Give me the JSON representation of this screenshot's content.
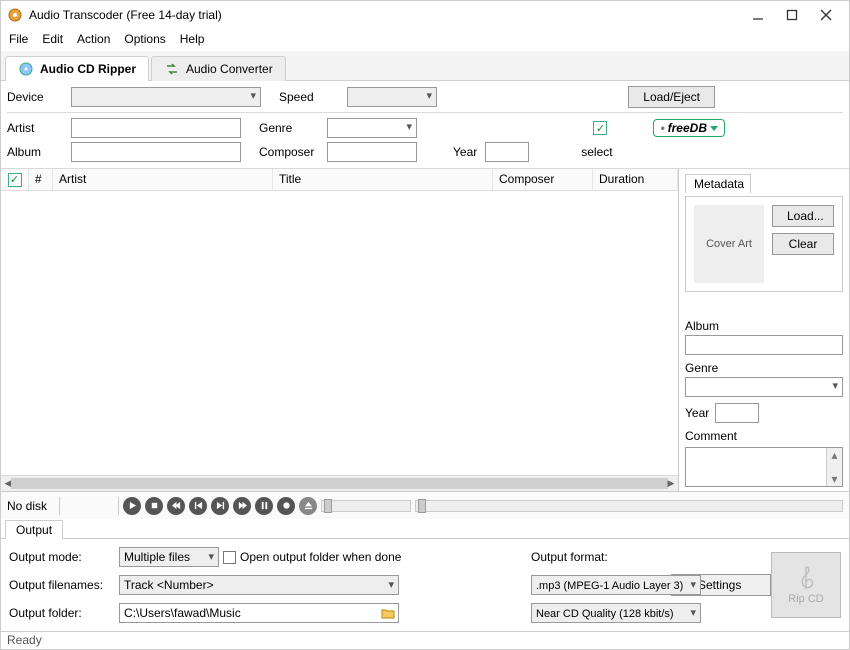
{
  "window": {
    "title": "Audio Transcoder (Free 14-day trial)"
  },
  "menu": [
    "File",
    "Edit",
    "Action",
    "Options",
    "Help"
  ],
  "tabs": {
    "ripper": "Audio CD Ripper",
    "converter": "Audio Converter"
  },
  "device_area": {
    "device_label": "Device",
    "speed_label": "Speed",
    "load_eject": "Load/Eject",
    "artist_label": "Artist",
    "genre_label": "Genre",
    "album_label": "Album",
    "composer_label": "Composer",
    "year_label": "Year",
    "select_label": "select",
    "freedb": "freeDB"
  },
  "columns": {
    "num": "#",
    "artist": "Artist",
    "title": "Title",
    "composer": "Composer",
    "duration": "Duration"
  },
  "metadata": {
    "tab": "Metadata",
    "cover": "Cover Art",
    "load": "Load...",
    "clear": "Clear",
    "album": "Album",
    "genre": "Genre",
    "year": "Year",
    "comment": "Comment"
  },
  "playbar": {
    "nodisk": "No disk"
  },
  "output": {
    "tab": "Output",
    "mode_label": "Output mode:",
    "mode_value": "Multiple files",
    "open_folder": "Open output folder when done",
    "filenames_label": "Output filenames:",
    "filenames_value": "Track <Number>",
    "folder_label": "Output folder:",
    "folder_value": "C:\\Users\\fawad\\Music",
    "format_label": "Output format:",
    "format_value": ".mp3 (MPEG-1 Audio Layer 3)",
    "quality_value": "Near CD Quality (128 kbit/s)",
    "settings": "Settings",
    "rip": "Rip CD"
  },
  "status": "Ready"
}
